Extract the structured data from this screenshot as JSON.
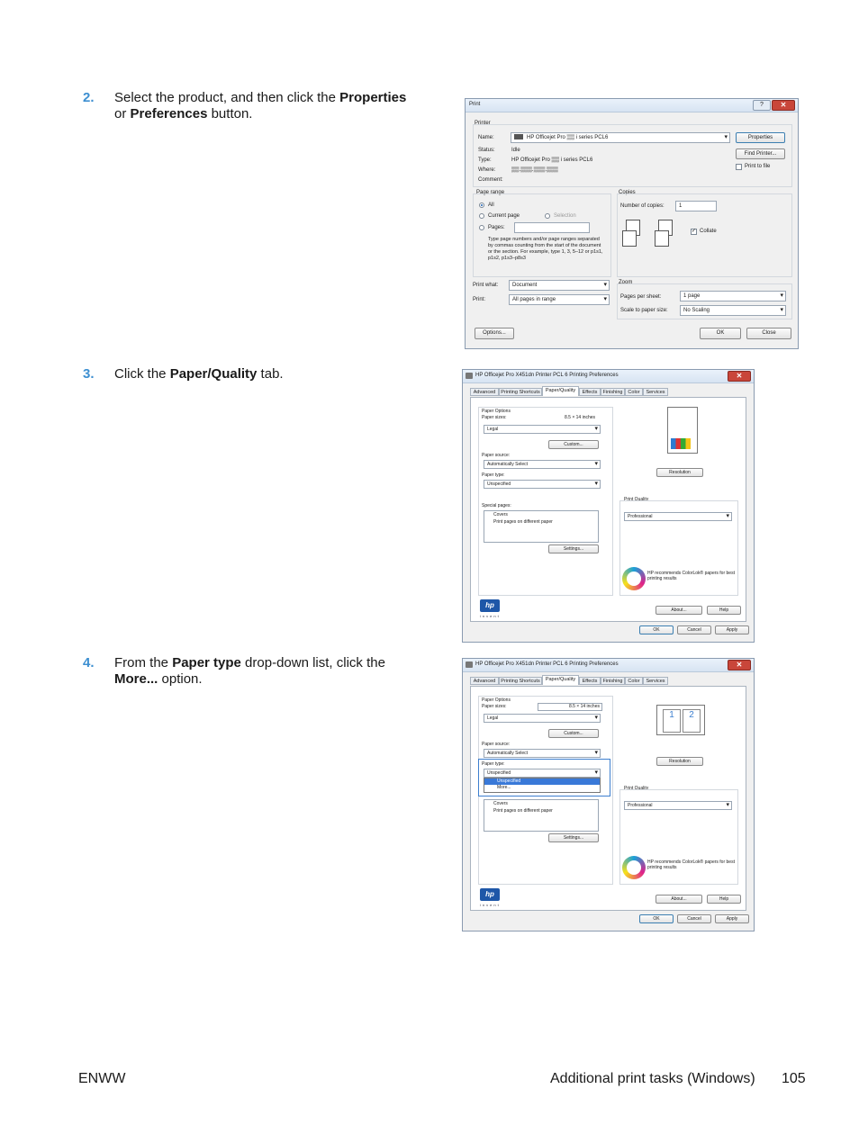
{
  "steps": [
    {
      "num": "2.",
      "t1": "Select the product, and then click the ",
      "b1": "Properties",
      "t2": " or ",
      "b2": "Preferences",
      "t3": " button."
    },
    {
      "num": "3.",
      "t1": "Click the ",
      "b1": "Paper/Quality",
      "t2": " tab."
    },
    {
      "num": "4.",
      "t1": "From the ",
      "b1": "Paper type",
      "t2": " drop-down list, click the ",
      "b2": "More...",
      "t3": " option."
    }
  ],
  "print_dialog": {
    "title": "Print",
    "help": "?",
    "close": "✕",
    "printer_label": "Printer",
    "name_label": "Name:",
    "name_value": "HP Officejet Pro ▒▒ i series PCL6",
    "status_label": "Status:",
    "status_value": "Idle",
    "type_label": "Type:",
    "type_value": "HP Officejet Pro ▒▒ i series PCL6",
    "where_label": "Where:",
    "where_value": "▒▒.▒▒▒.▒▒▒.▒▒▒",
    "comment_label": "Comment:",
    "properties": "Properties",
    "find_printer": "Find Printer...",
    "print_to_file": "Print to file",
    "page_range_label": "Page range",
    "all": "All",
    "current_page": "Current page",
    "selection": "Selection",
    "pages": "Pages:",
    "range_help": "Type page numbers and/or page ranges separated by commas counting from the start of the document or the section. For example, type 1, 3, 5–12 or p1s1, p1s2, p1s3–p8s3",
    "copies_label": "Copies",
    "num_copies_label": "Number of copies:",
    "num_copies_value": "1",
    "collate": "Collate",
    "print_what_label": "Print what:",
    "print_what_value": "Document",
    "print_label": "Print:",
    "print_value": "All pages in range",
    "zoom_label": "Zoom",
    "pages_per_sheet_label": "Pages per sheet:",
    "pages_per_sheet_value": "1 page",
    "scale_label": "Scale to paper size:",
    "scale_value": "No Scaling",
    "options": "Options...",
    "ok": "OK",
    "close_btn": "Close"
  },
  "pref_dialog": {
    "title": "HP Officejet Pro X451dn Printer PCL 6 Printing Preferences",
    "close": "✕",
    "tabs": [
      "Advanced",
      "Printing Shortcuts",
      "Paper/Quality",
      "Effects",
      "Finishing",
      "Color",
      "Services"
    ],
    "paper_options": "Paper Options",
    "paper_sizes": "Paper sizes:",
    "paper_size_value": "8.5 × 14 inches",
    "legal": "Legal",
    "custom": "Custom...",
    "paper_source": "Paper source:",
    "paper_source_value": "Automatically Select",
    "paper_type": "Paper type:",
    "paper_type_value": "Unspecified",
    "special_pages": "Special pages:",
    "covers": "Covers",
    "diff_paper": "Print pages on different paper",
    "settings": "Settings...",
    "resolution": "Resolution",
    "print_quality": "Print Quality",
    "professional": "Professional",
    "colorlok_text": "HP recommends ColorLok® papers for best printing results",
    "about": "About...",
    "help": "Help",
    "ok": "OK",
    "cancel": "Cancel",
    "apply": "Apply",
    "dropdown_items": [
      "Unspecified",
      "More..."
    ],
    "logo": "hp",
    "invent": "invent"
  },
  "footer": {
    "left": "ENWW",
    "right": "Additional print tasks (Windows)",
    "page": "105"
  }
}
